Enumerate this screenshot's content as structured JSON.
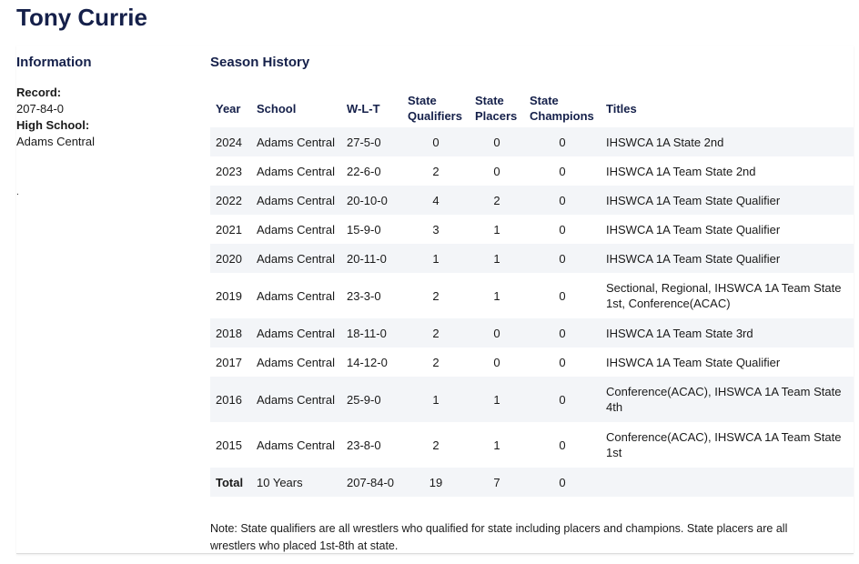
{
  "wrestler": {
    "name": "Tony Currie"
  },
  "info": {
    "heading": "Information",
    "record_label": "Record:",
    "record_value": "207-84-0",
    "school_label": "High School:",
    "school_value": "Adams Central",
    "stray": "."
  },
  "history": {
    "heading": "Season History",
    "headers": {
      "year": "Year",
      "school": "School",
      "wlt": "W-L-T",
      "state_qualifiers": "State Qualifiers",
      "state_placers": "State Placers",
      "state_champions": "State Champions",
      "titles": "Titles"
    },
    "rows": [
      {
        "year": "2024",
        "school": "Adams Central",
        "wlt": "27-5-0",
        "qualifiers": "0",
        "placers": "0",
        "champions": "0",
        "titles": "IHSWCA 1A State 2nd"
      },
      {
        "year": "2023",
        "school": "Adams Central",
        "wlt": "22-6-0",
        "qualifiers": "2",
        "placers": "0",
        "champions": "0",
        "titles": "IHSWCA 1A Team State 2nd"
      },
      {
        "year": "2022",
        "school": "Adams Central",
        "wlt": "20-10-0",
        "qualifiers": "4",
        "placers": "2",
        "champions": "0",
        "titles": "IHSWCA 1A Team State Qualifier"
      },
      {
        "year": "2021",
        "school": "Adams Central",
        "wlt": "15-9-0",
        "qualifiers": "3",
        "placers": "1",
        "champions": "0",
        "titles": "IHSWCA 1A Team State Qualifier"
      },
      {
        "year": "2020",
        "school": "Adams Central",
        "wlt": "20-11-0",
        "qualifiers": "1",
        "placers": "1",
        "champions": "0",
        "titles": "IHSWCA 1A Team State Qualifier"
      },
      {
        "year": "2019",
        "school": "Adams Central",
        "wlt": "23-3-0",
        "qualifiers": "2",
        "placers": "1",
        "champions": "0",
        "titles": "Sectional, Regional, IHSWCA 1A Team State 1st, Conference(ACAC)"
      },
      {
        "year": "2018",
        "school": "Adams Central",
        "wlt": "18-11-0",
        "qualifiers": "2",
        "placers": "0",
        "champions": "0",
        "titles": "IHSWCA 1A Team State 3rd"
      },
      {
        "year": "2017",
        "school": "Adams Central",
        "wlt": "14-12-0",
        "qualifiers": "2",
        "placers": "0",
        "champions": "0",
        "titles": "IHSWCA 1A Team State Qualifier"
      },
      {
        "year": "2016",
        "school": "Adams Central",
        "wlt": "25-9-0",
        "qualifiers": "1",
        "placers": "1",
        "champions": "0",
        "titles": "Conference(ACAC), IHSWCA 1A Team State 4th"
      },
      {
        "year": "2015",
        "school": "Adams Central",
        "wlt": "23-8-0",
        "qualifiers": "2",
        "placers": "1",
        "champions": "0",
        "titles": "Conference(ACAC), IHSWCA 1A Team State 1st"
      }
    ],
    "total": {
      "label": "Total",
      "years": "10 Years",
      "wlt": "207-84-0",
      "qualifiers": "19",
      "placers": "7",
      "champions": "0"
    },
    "note": "Note: State qualifiers are all wrestlers who qualified for state including placers and champions. State placers are all wrestlers who placed 1st-8th at state."
  },
  "colors": {
    "heading": "#15204a",
    "row_stripe": "#f3f5f8"
  }
}
